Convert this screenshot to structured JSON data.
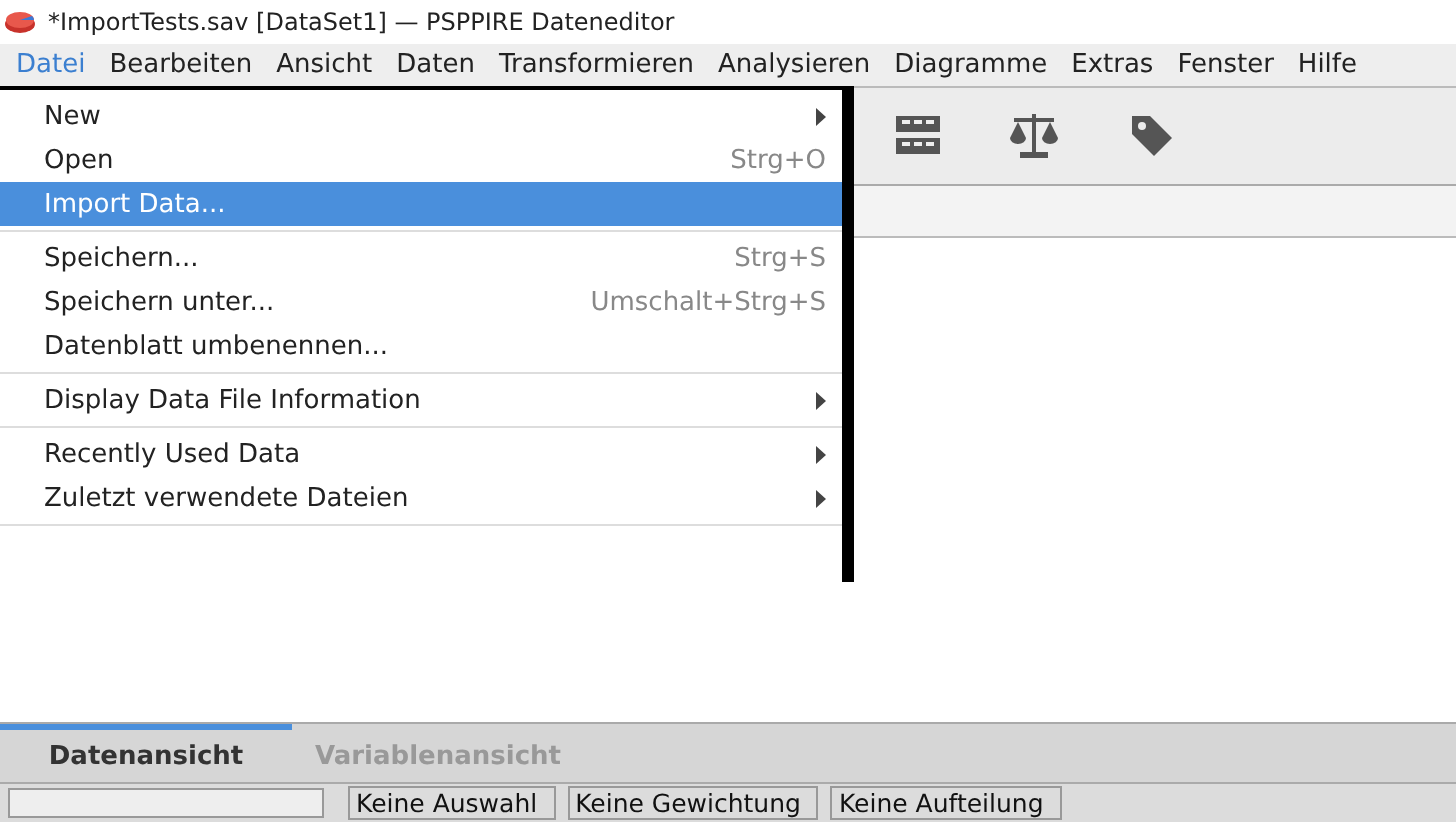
{
  "window": {
    "title": "*ImportTests.sav [DataSet1] — PSPPIRE Dateneditor"
  },
  "menubar": [
    {
      "label": "Datei",
      "selected": true
    },
    {
      "label": "Bearbeiten",
      "selected": false
    },
    {
      "label": "Ansicht",
      "selected": false
    },
    {
      "label": "Daten",
      "selected": false
    },
    {
      "label": "Transformieren",
      "selected": false
    },
    {
      "label": "Analysieren",
      "selected": false
    },
    {
      "label": "Diagramme",
      "selected": false
    },
    {
      "label": "Extras",
      "selected": false
    },
    {
      "label": "Fenster",
      "selected": false
    },
    {
      "label": "Hilfe",
      "selected": false
    }
  ],
  "file_menu": [
    [
      {
        "label": "New",
        "submenu": true,
        "selected": false
      },
      {
        "label": "Open",
        "shortcut": "Strg+O",
        "submenu": false,
        "selected": false
      },
      {
        "label": "Import Data...",
        "submenu": false,
        "selected": true
      }
    ],
    [
      {
        "label": "Speichern...",
        "shortcut": "Strg+S",
        "submenu": false,
        "selected": false
      },
      {
        "label": "Speichern unter...",
        "shortcut": "Umschalt+Strg+S",
        "submenu": false,
        "selected": false
      },
      {
        "label": "Datenblatt umbenennen...",
        "submenu": false,
        "selected": false
      }
    ],
    [
      {
        "label": "Display Data File Information",
        "submenu": true,
        "selected": false
      }
    ],
    [
      {
        "label": "Recently Used Data",
        "submenu": true,
        "selected": false
      },
      {
        "label": "Zuletzt verwendete Dateien",
        "submenu": true,
        "selected": false
      }
    ]
  ],
  "tabs": [
    {
      "label": "Datenansicht",
      "selected": true
    },
    {
      "label": "Variablenansicht",
      "selected": false
    }
  ],
  "status_bar": [
    "Keine Auswahl",
    "Keine Gewichtung",
    "Keine Aufteilung"
  ]
}
